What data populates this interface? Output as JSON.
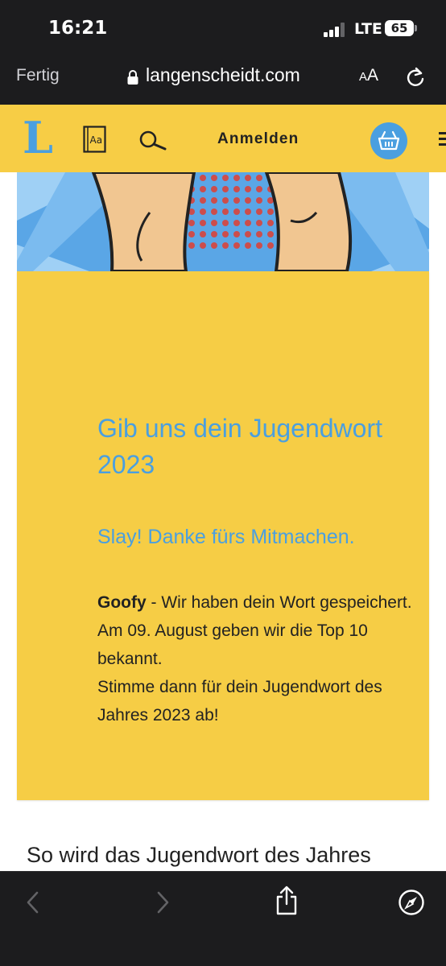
{
  "status_bar": {
    "time": "16:21",
    "network": "LTE",
    "battery": "65"
  },
  "browser": {
    "done_label": "Fertig",
    "url": "langenscheidt.com",
    "text_size_label": {
      "small": "A",
      "large": "A"
    }
  },
  "header": {
    "logo_text": "L",
    "dictionary_icon_text": "Aa",
    "login_label": "Anmelden"
  },
  "card": {
    "title": "Gib uns dein Jugendwort 2023",
    "subtitle": "Slay! Danke fürs Mitmachen.",
    "word": "Goofy",
    "saved_text": " - Wir haben dein Wort gespeichert.",
    "line2": "Am 09. August geben wir die Top 10 bekannt.",
    "line3": "Stimme dann für dein Jugendwort des Jahres 2023 ab!"
  },
  "section_heading": "So wird das Jugendwort des Jahres",
  "colors": {
    "brand_yellow": "#f6cd45",
    "brand_blue": "#4a9fe0",
    "toolbar_dark": "#1c1c1e"
  },
  "icons": {
    "header": [
      "dictionary-icon",
      "search-icon",
      "basket-icon",
      "menu-icon"
    ],
    "toolbar": [
      "back-icon",
      "forward-icon",
      "share-icon",
      "compass-icon"
    ]
  }
}
